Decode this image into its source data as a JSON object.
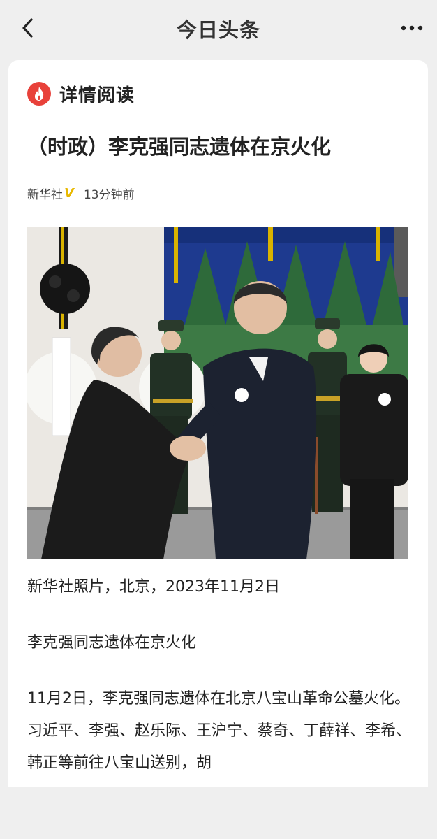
{
  "topbar": {
    "title": "今日头条",
    "back_icon": "chevron-left-icon",
    "more_icon": "more-horizontal-icon"
  },
  "card": {
    "header_label": "详情阅读",
    "brand_icon": "fire-logo-icon",
    "brand_color": "#e8413a",
    "headline": "（时政）李克强同志遗体在京火化",
    "source": "新华社",
    "verified_mark": "V",
    "verified_color": "#e8b800",
    "time": "13分钟前"
  },
  "article": {
    "paragraphs": [
      "新华社照片，北京，2023年11月2日",
      "李克强同志遗体在京火化",
      "11月2日，李克强同志遗体在北京八宝山革命公墓火化。习近平、李强、赵乐际、王沪宁、蔡奇、丁薛祥、李希、韩正等前往八宝山送别，胡"
    ]
  }
}
